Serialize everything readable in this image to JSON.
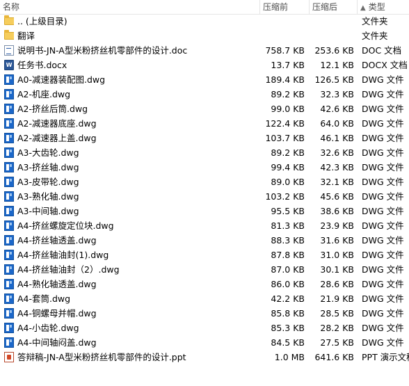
{
  "columns": {
    "name": "名称",
    "size_before": "压缩前",
    "size_after": "压缩后",
    "type": "类型",
    "sort_indicator": "▲"
  },
  "rows": [
    {
      "icon": "folder-icon",
      "name": ".. (上级目录)",
      "size_before": "",
      "size_after": "",
      "type": "文件夹"
    },
    {
      "icon": "folder-icon",
      "name": "翻译",
      "size_before": "",
      "size_after": "",
      "type": "文件夹"
    },
    {
      "icon": "doc-file-icon",
      "name": "说明书-JN-A型米粉挤丝机零部件的设计.doc",
      "size_before": "758.7 KB",
      "size_after": "253.6 KB",
      "type": "DOC 文档"
    },
    {
      "icon": "docx-file-icon",
      "name": "任务书.docx",
      "size_before": "13.7 KB",
      "size_after": "12.1 KB",
      "type": "DOCX 文档"
    },
    {
      "icon": "dwg-file-icon",
      "name": "A0-减速器装配图.dwg",
      "size_before": "189.4 KB",
      "size_after": "126.5 KB",
      "type": "DWG 文件"
    },
    {
      "icon": "dwg-file-icon",
      "name": "A2-机座.dwg",
      "size_before": "89.2 KB",
      "size_after": "32.3 KB",
      "type": "DWG 文件"
    },
    {
      "icon": "dwg-file-icon",
      "name": "A2-挤丝后筒.dwg",
      "size_before": "99.0 KB",
      "size_after": "42.6 KB",
      "type": "DWG 文件"
    },
    {
      "icon": "dwg-file-icon",
      "name": "A2-减速器底座.dwg",
      "size_before": "122.4 KB",
      "size_after": "64.0 KB",
      "type": "DWG 文件"
    },
    {
      "icon": "dwg-file-icon",
      "name": "A2-减速器上盖.dwg",
      "size_before": "103.7 KB",
      "size_after": "46.1 KB",
      "type": "DWG 文件"
    },
    {
      "icon": "dwg-file-icon",
      "name": "A3-大齿轮.dwg",
      "size_before": "89.2 KB",
      "size_after": "32.6 KB",
      "type": "DWG 文件"
    },
    {
      "icon": "dwg-file-icon",
      "name": "A3-挤丝轴.dwg",
      "size_before": "99.4 KB",
      "size_after": "42.3 KB",
      "type": "DWG 文件"
    },
    {
      "icon": "dwg-file-icon",
      "name": "A3-皮带轮.dwg",
      "size_before": "89.0 KB",
      "size_after": "32.1 KB",
      "type": "DWG 文件"
    },
    {
      "icon": "dwg-file-icon",
      "name": "A3-熟化轴.dwg",
      "size_before": "103.2 KB",
      "size_after": "45.6 KB",
      "type": "DWG 文件"
    },
    {
      "icon": "dwg-file-icon",
      "name": "A3-中间轴.dwg",
      "size_before": "95.5 KB",
      "size_after": "38.6 KB",
      "type": "DWG 文件"
    },
    {
      "icon": "dwg-file-icon",
      "name": "A4-挤丝螺旋定位块.dwg",
      "size_before": "81.3 KB",
      "size_after": "23.9 KB",
      "type": "DWG 文件"
    },
    {
      "icon": "dwg-file-icon",
      "name": "A4-挤丝轴透盖.dwg",
      "size_before": "88.3 KB",
      "size_after": "31.6 KB",
      "type": "DWG 文件"
    },
    {
      "icon": "dwg-file-icon",
      "name": "A4-挤丝轴油封(1).dwg",
      "size_before": "87.8 KB",
      "size_after": "31.0 KB",
      "type": "DWG 文件"
    },
    {
      "icon": "dwg-file-icon",
      "name": "A4-挤丝轴油封（2）.dwg",
      "size_before": "87.0 KB",
      "size_after": "30.1 KB",
      "type": "DWG 文件"
    },
    {
      "icon": "dwg-file-icon",
      "name": "A4-熟化轴透盖.dwg",
      "size_before": "86.0 KB",
      "size_after": "28.6 KB",
      "type": "DWG 文件"
    },
    {
      "icon": "dwg-file-icon",
      "name": "A4-套筒.dwg",
      "size_before": "42.2 KB",
      "size_after": "21.9 KB",
      "type": "DWG 文件"
    },
    {
      "icon": "dwg-file-icon",
      "name": "A4-铜螺母并帽.dwg",
      "size_before": "85.8 KB",
      "size_after": "28.5 KB",
      "type": "DWG 文件"
    },
    {
      "icon": "dwg-file-icon",
      "name": "A4-小齿轮.dwg",
      "size_before": "85.3 KB",
      "size_after": "28.2 KB",
      "type": "DWG 文件"
    },
    {
      "icon": "dwg-file-icon",
      "name": "A4-中间轴闷盖.dwg",
      "size_before": "84.5 KB",
      "size_after": "27.5 KB",
      "type": "DWG 文件"
    },
    {
      "icon": "ppt-file-icon",
      "name": "答辩稿-JN-A型米粉挤丝机零部件的设计.ppt",
      "size_before": "1.0 MB",
      "size_after": "641.6 KB",
      "type": "PPT 演示文稿"
    }
  ]
}
